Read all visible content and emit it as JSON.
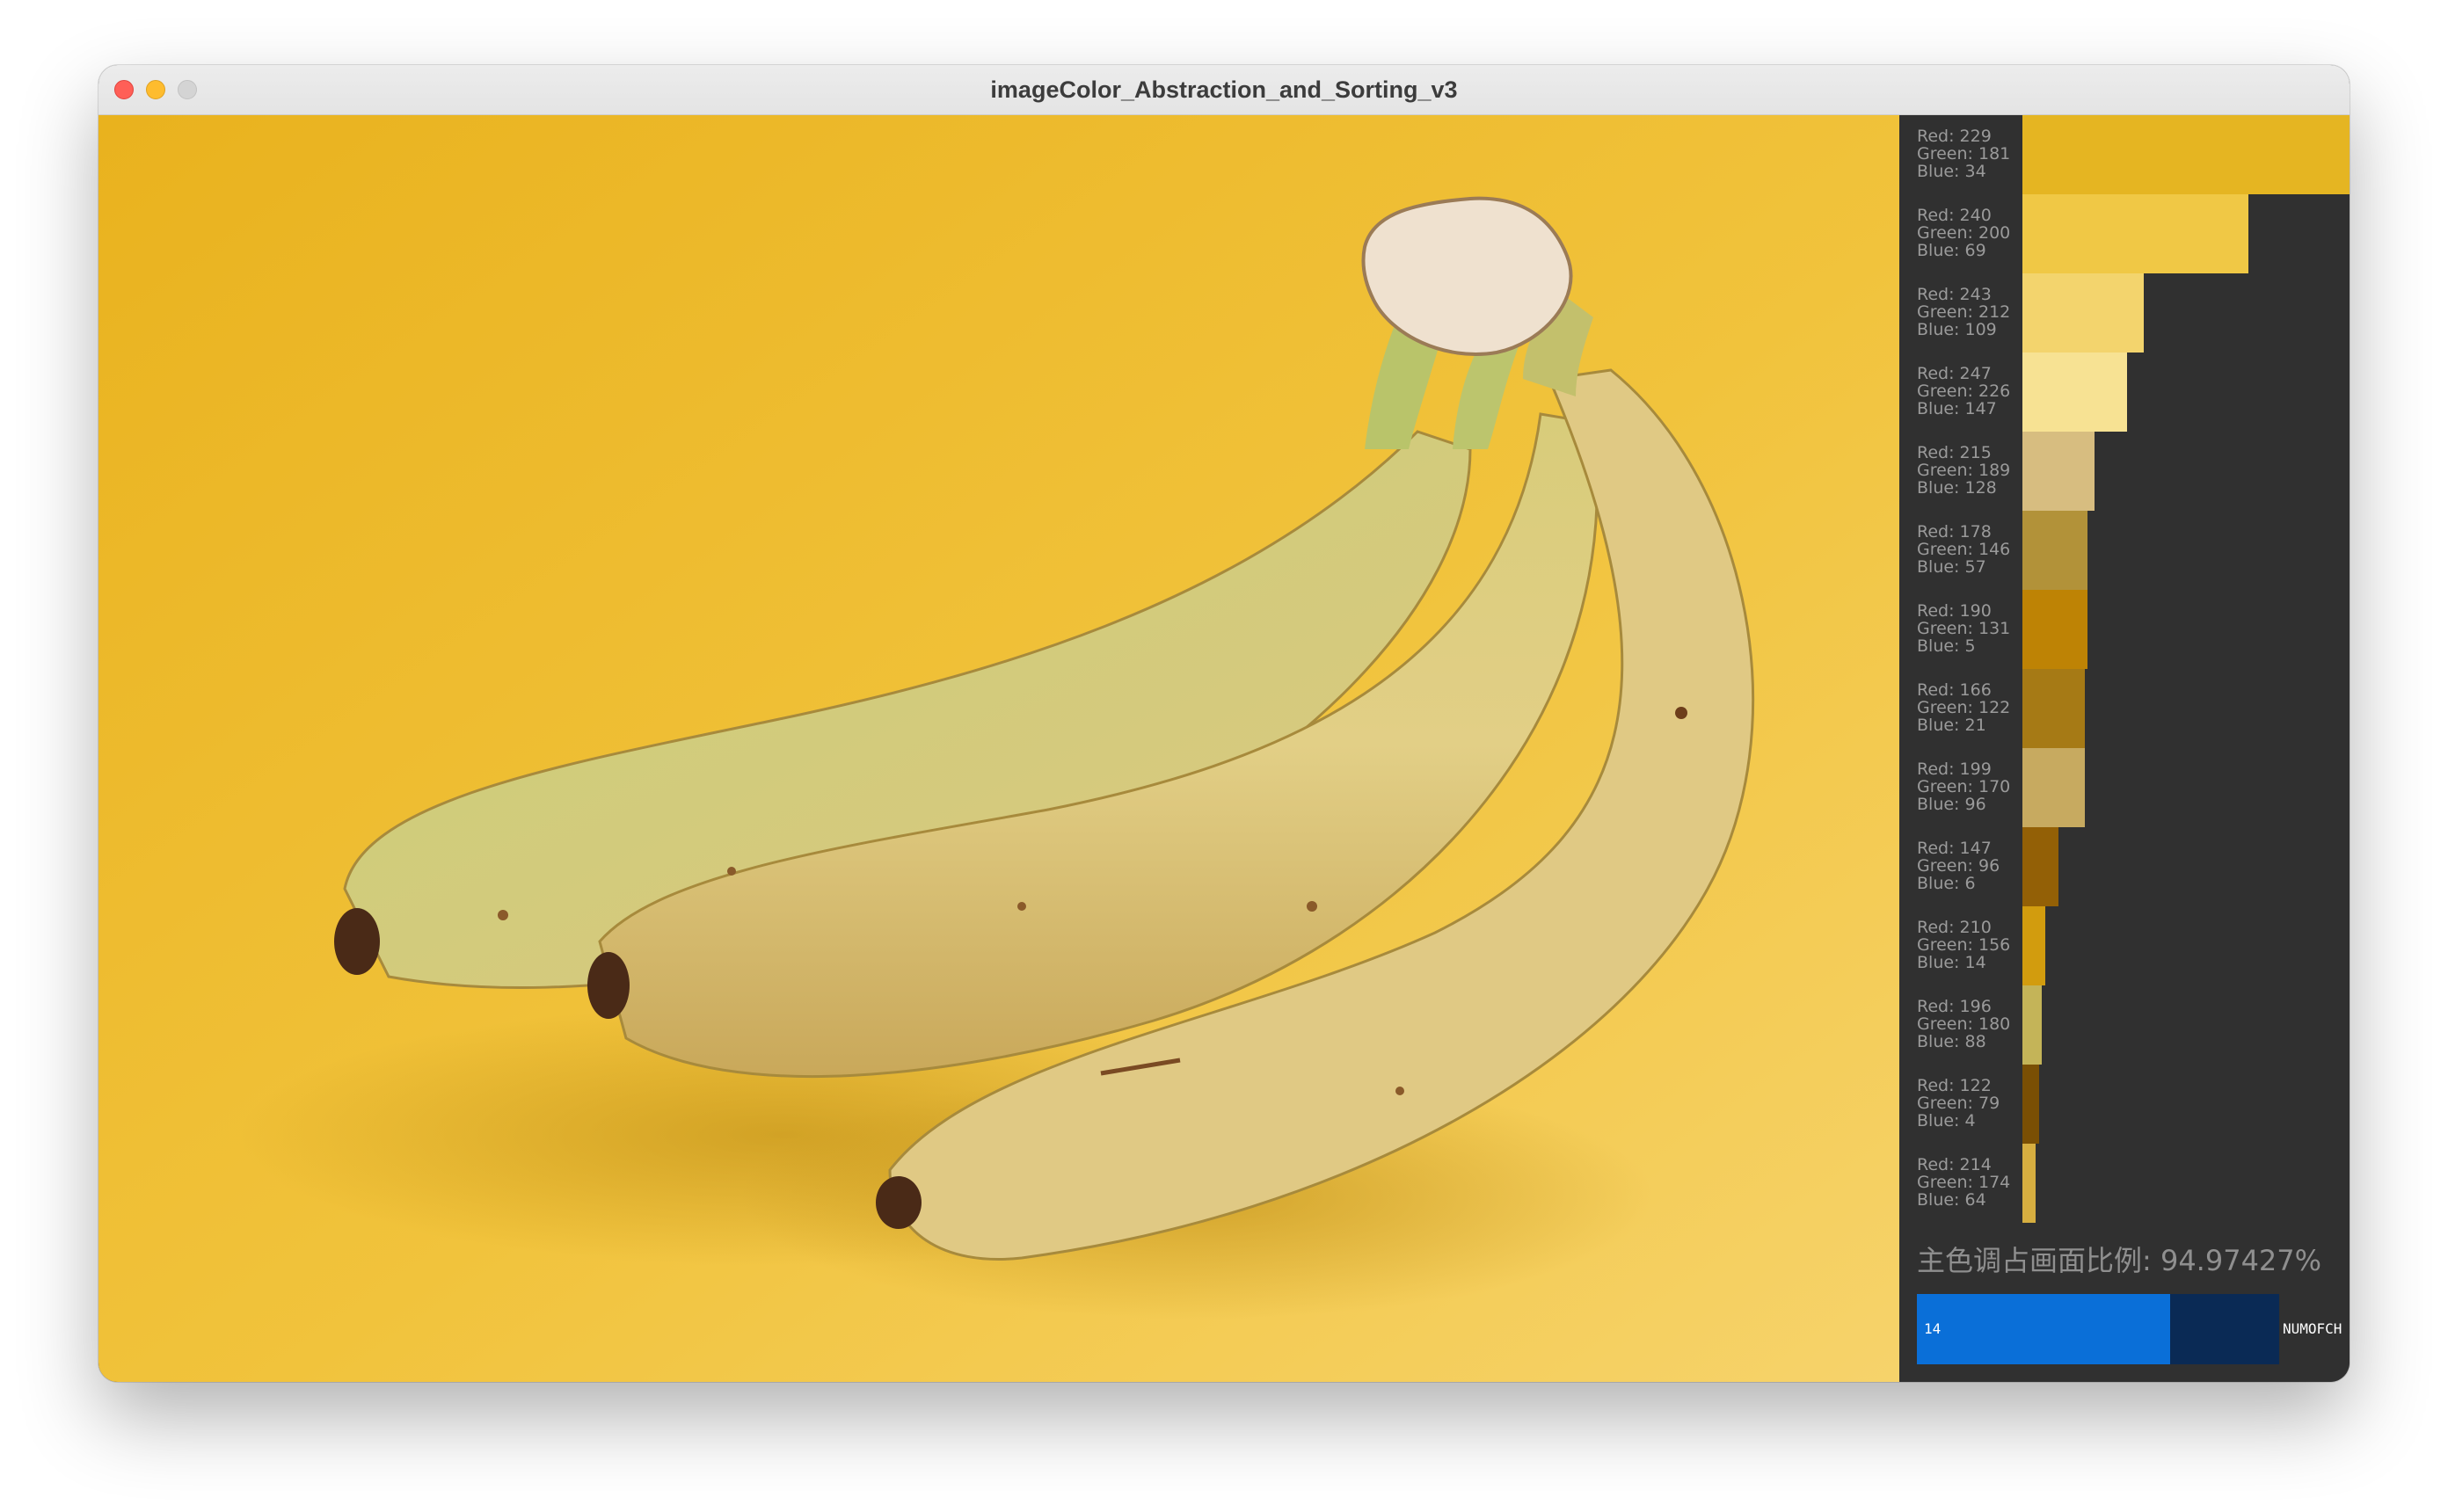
{
  "window": {
    "title": "imageColor_Abstraction_and_Sorting_v3"
  },
  "photo": {
    "subject": "banana-bunch",
    "background_color": "#eebb2a"
  },
  "swatches": [
    {
      "red": 229,
      "green": 181,
      "blue": 34,
      "share": 1.0
    },
    {
      "red": 240,
      "green": 200,
      "blue": 69,
      "share": 0.69
    },
    {
      "red": 243,
      "green": 212,
      "blue": 109,
      "share": 0.37
    },
    {
      "red": 247,
      "green": 226,
      "blue": 147,
      "share": 0.32
    },
    {
      "red": 215,
      "green": 189,
      "blue": 128,
      "share": 0.22
    },
    {
      "red": 178,
      "green": 146,
      "blue": 57,
      "share": 0.2
    },
    {
      "red": 190,
      "green": 131,
      "blue": 5,
      "share": 0.2
    },
    {
      "red": 166,
      "green": 122,
      "blue": 21,
      "share": 0.19
    },
    {
      "red": 199,
      "green": 170,
      "blue": 96,
      "share": 0.19
    },
    {
      "red": 147,
      "green": 96,
      "blue": 6,
      "share": 0.11
    },
    {
      "red": 210,
      "green": 156,
      "blue": 14,
      "share": 0.07
    },
    {
      "red": 196,
      "green": 180,
      "blue": 88,
      "share": 0.06
    },
    {
      "red": 122,
      "green": 79,
      "blue": 4,
      "share": 0.05
    },
    {
      "red": 214,
      "green": 174,
      "blue": 64,
      "share": 0.04
    }
  ],
  "labels": {
    "red": "Red: ",
    "green": "Green: ",
    "blue": "Blue: "
  },
  "summary": {
    "ratio_text": "主色调占画面比例: 94.97427%"
  },
  "slider": {
    "value": "14",
    "label": "NUMOFCH",
    "fill_fraction": 0.7
  }
}
